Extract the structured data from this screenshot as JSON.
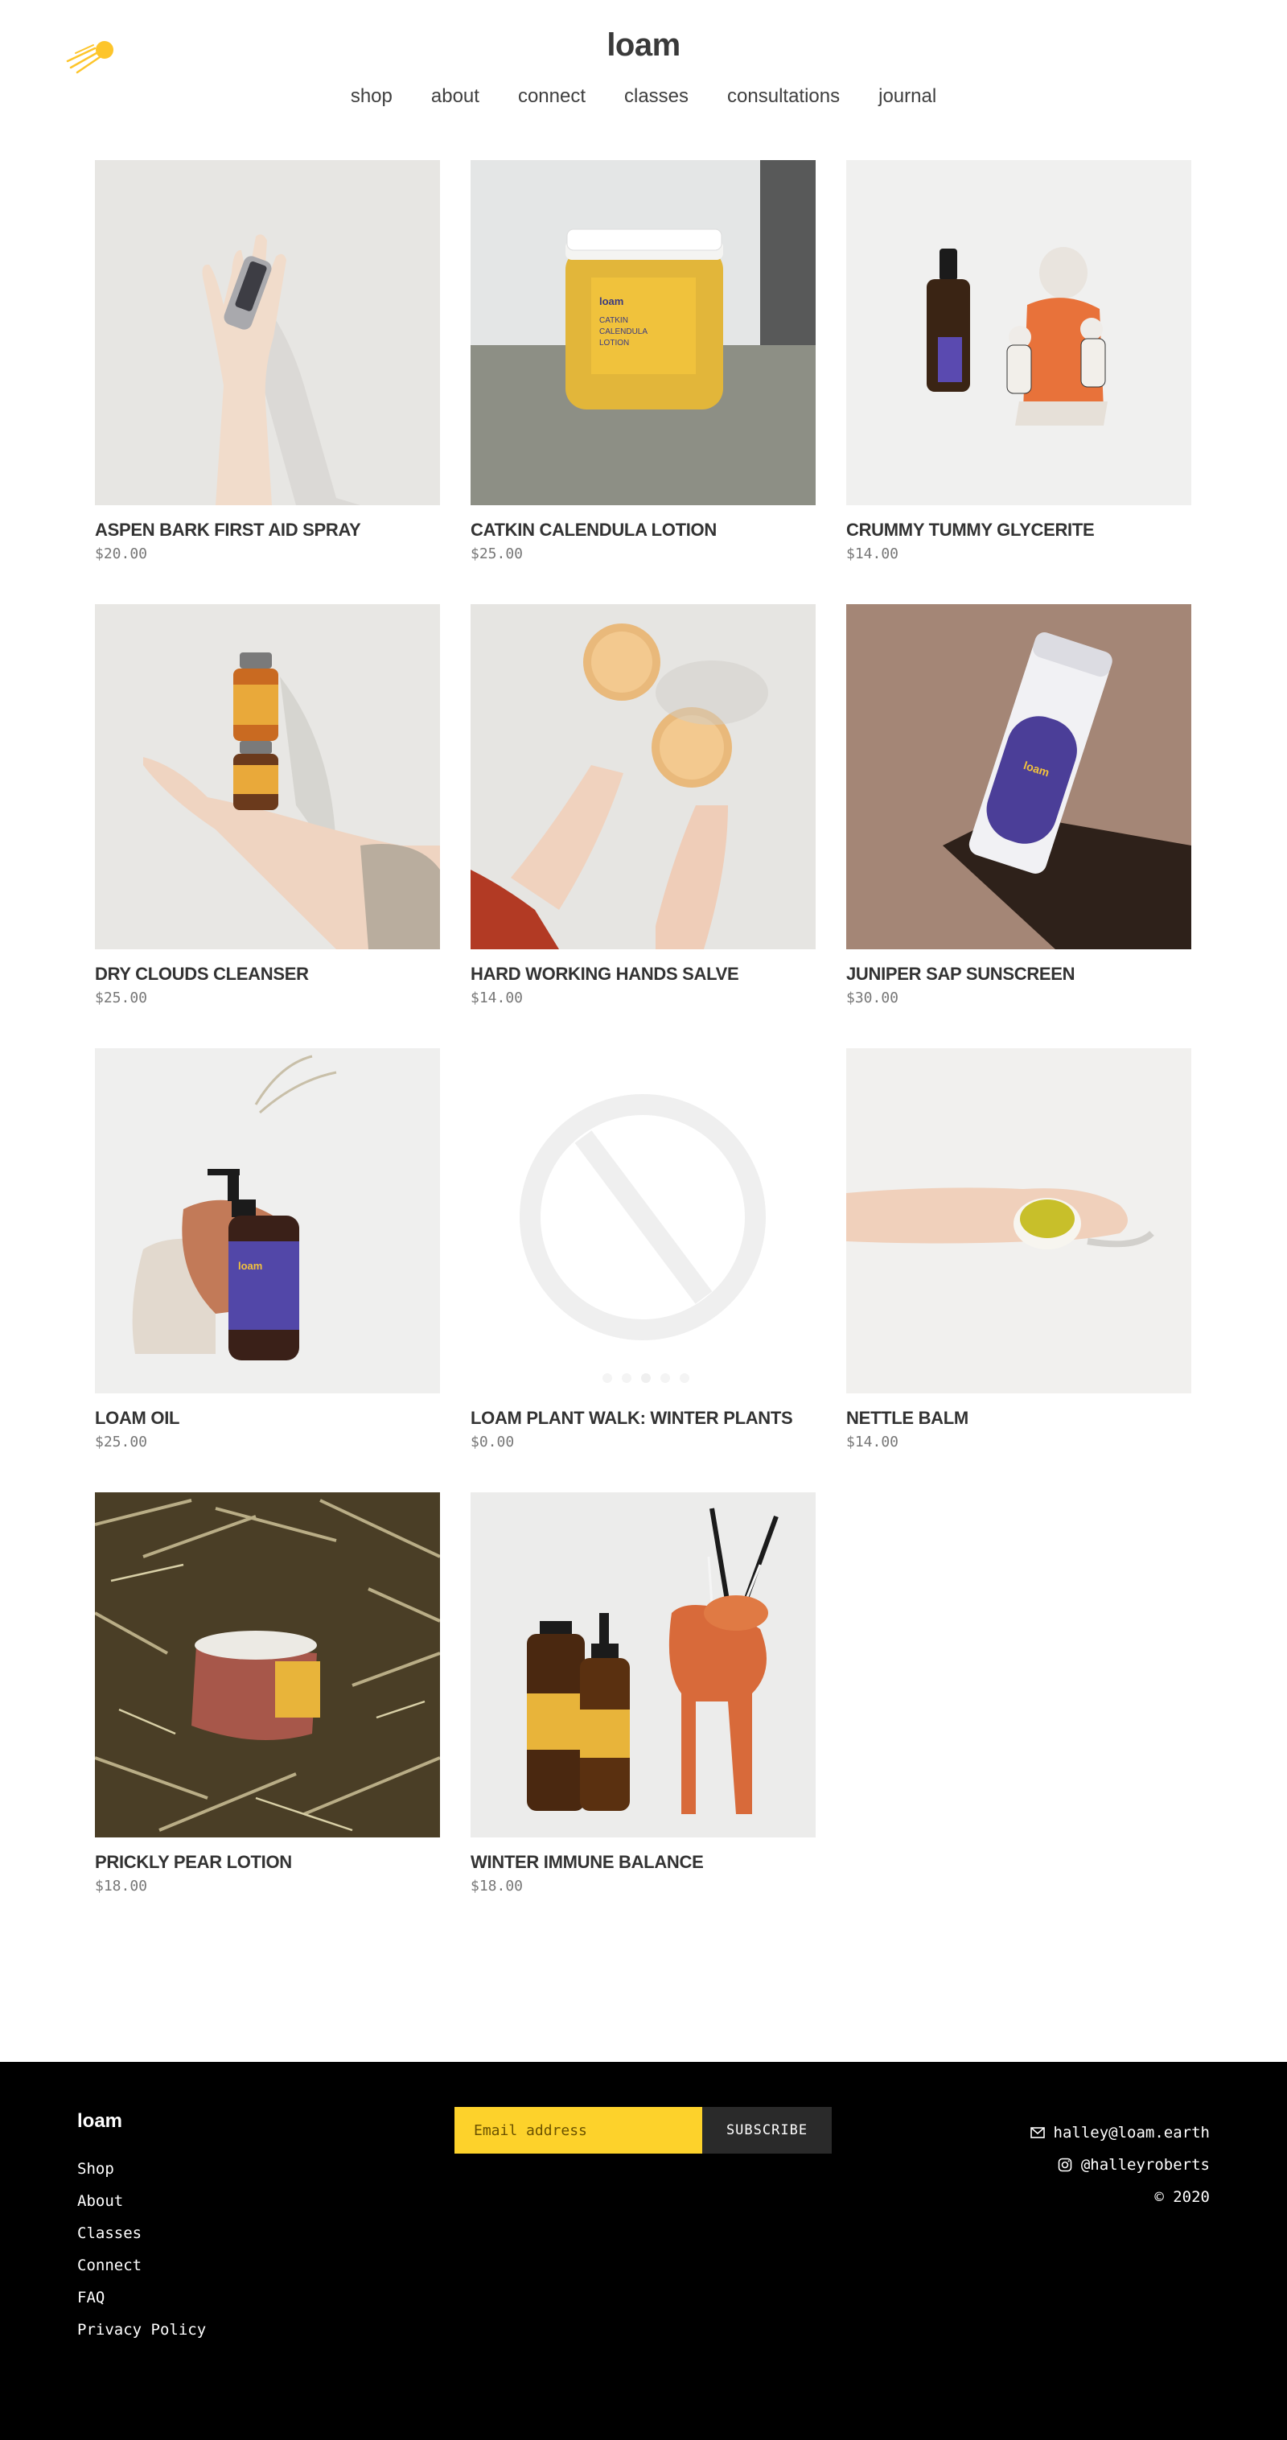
{
  "header": {
    "brand": "loam",
    "logo_icon": "comet-icon",
    "accent": "#fdc52b",
    "nav": [
      "shop",
      "about",
      "connect",
      "classes",
      "consultations",
      "journal"
    ]
  },
  "products": [
    {
      "name": "ASPEN BARK FIRST AID SPRAY",
      "price": "$20.00",
      "image": "hand-holding-spray-bottle"
    },
    {
      "name": "CATKIN CALENDULA LOTION",
      "price": "$25.00",
      "image": "lotion-jar"
    },
    {
      "name": "CRUMMY TUMMY GLYCERITE",
      "price": "$14.00",
      "image": "dropper-bottle-with-figurine"
    },
    {
      "name": "DRY CLOUDS CLEANSER",
      "price": "$25.00",
      "image": "hand-balancing-jars"
    },
    {
      "name": "HARD WORKING HANDS SALVE",
      "price": "$14.00",
      "image": "hands-holding-salve-tins"
    },
    {
      "name": "JUNIPER SAP SUNSCREEN",
      "price": "$30.00",
      "image": "sunscreen-stick"
    },
    {
      "name": "LOAM OIL",
      "price": "$25.00",
      "image": "pump-bottle-with-stone"
    },
    {
      "name": "LOAM PLANT WALK: WINTER PLANTS",
      "price": "$0.00",
      "image": "no-image-placeholder"
    },
    {
      "name": "NETTLE BALM",
      "price": "$14.00",
      "image": "hand-holding-balm-tin"
    },
    {
      "name": "PRICKLY PEAR LOTION",
      "price": "$18.00",
      "image": "jar-in-dried-plants"
    },
    {
      "name": "WINTER IMMUNE BALANCE",
      "price": "$18.00",
      "image": "bottles-with-deer-figurine"
    }
  ],
  "footer": {
    "brand": "loam",
    "links": [
      "Shop",
      "About",
      "Classes",
      "Connect",
      "FAQ",
      "Privacy Policy"
    ],
    "newsletter": {
      "placeholder": "Email address",
      "button": "SUBSCRIBE"
    },
    "email": "halley@loam.earth",
    "instagram": "@halleyroberts",
    "copyright": "© 2020"
  }
}
